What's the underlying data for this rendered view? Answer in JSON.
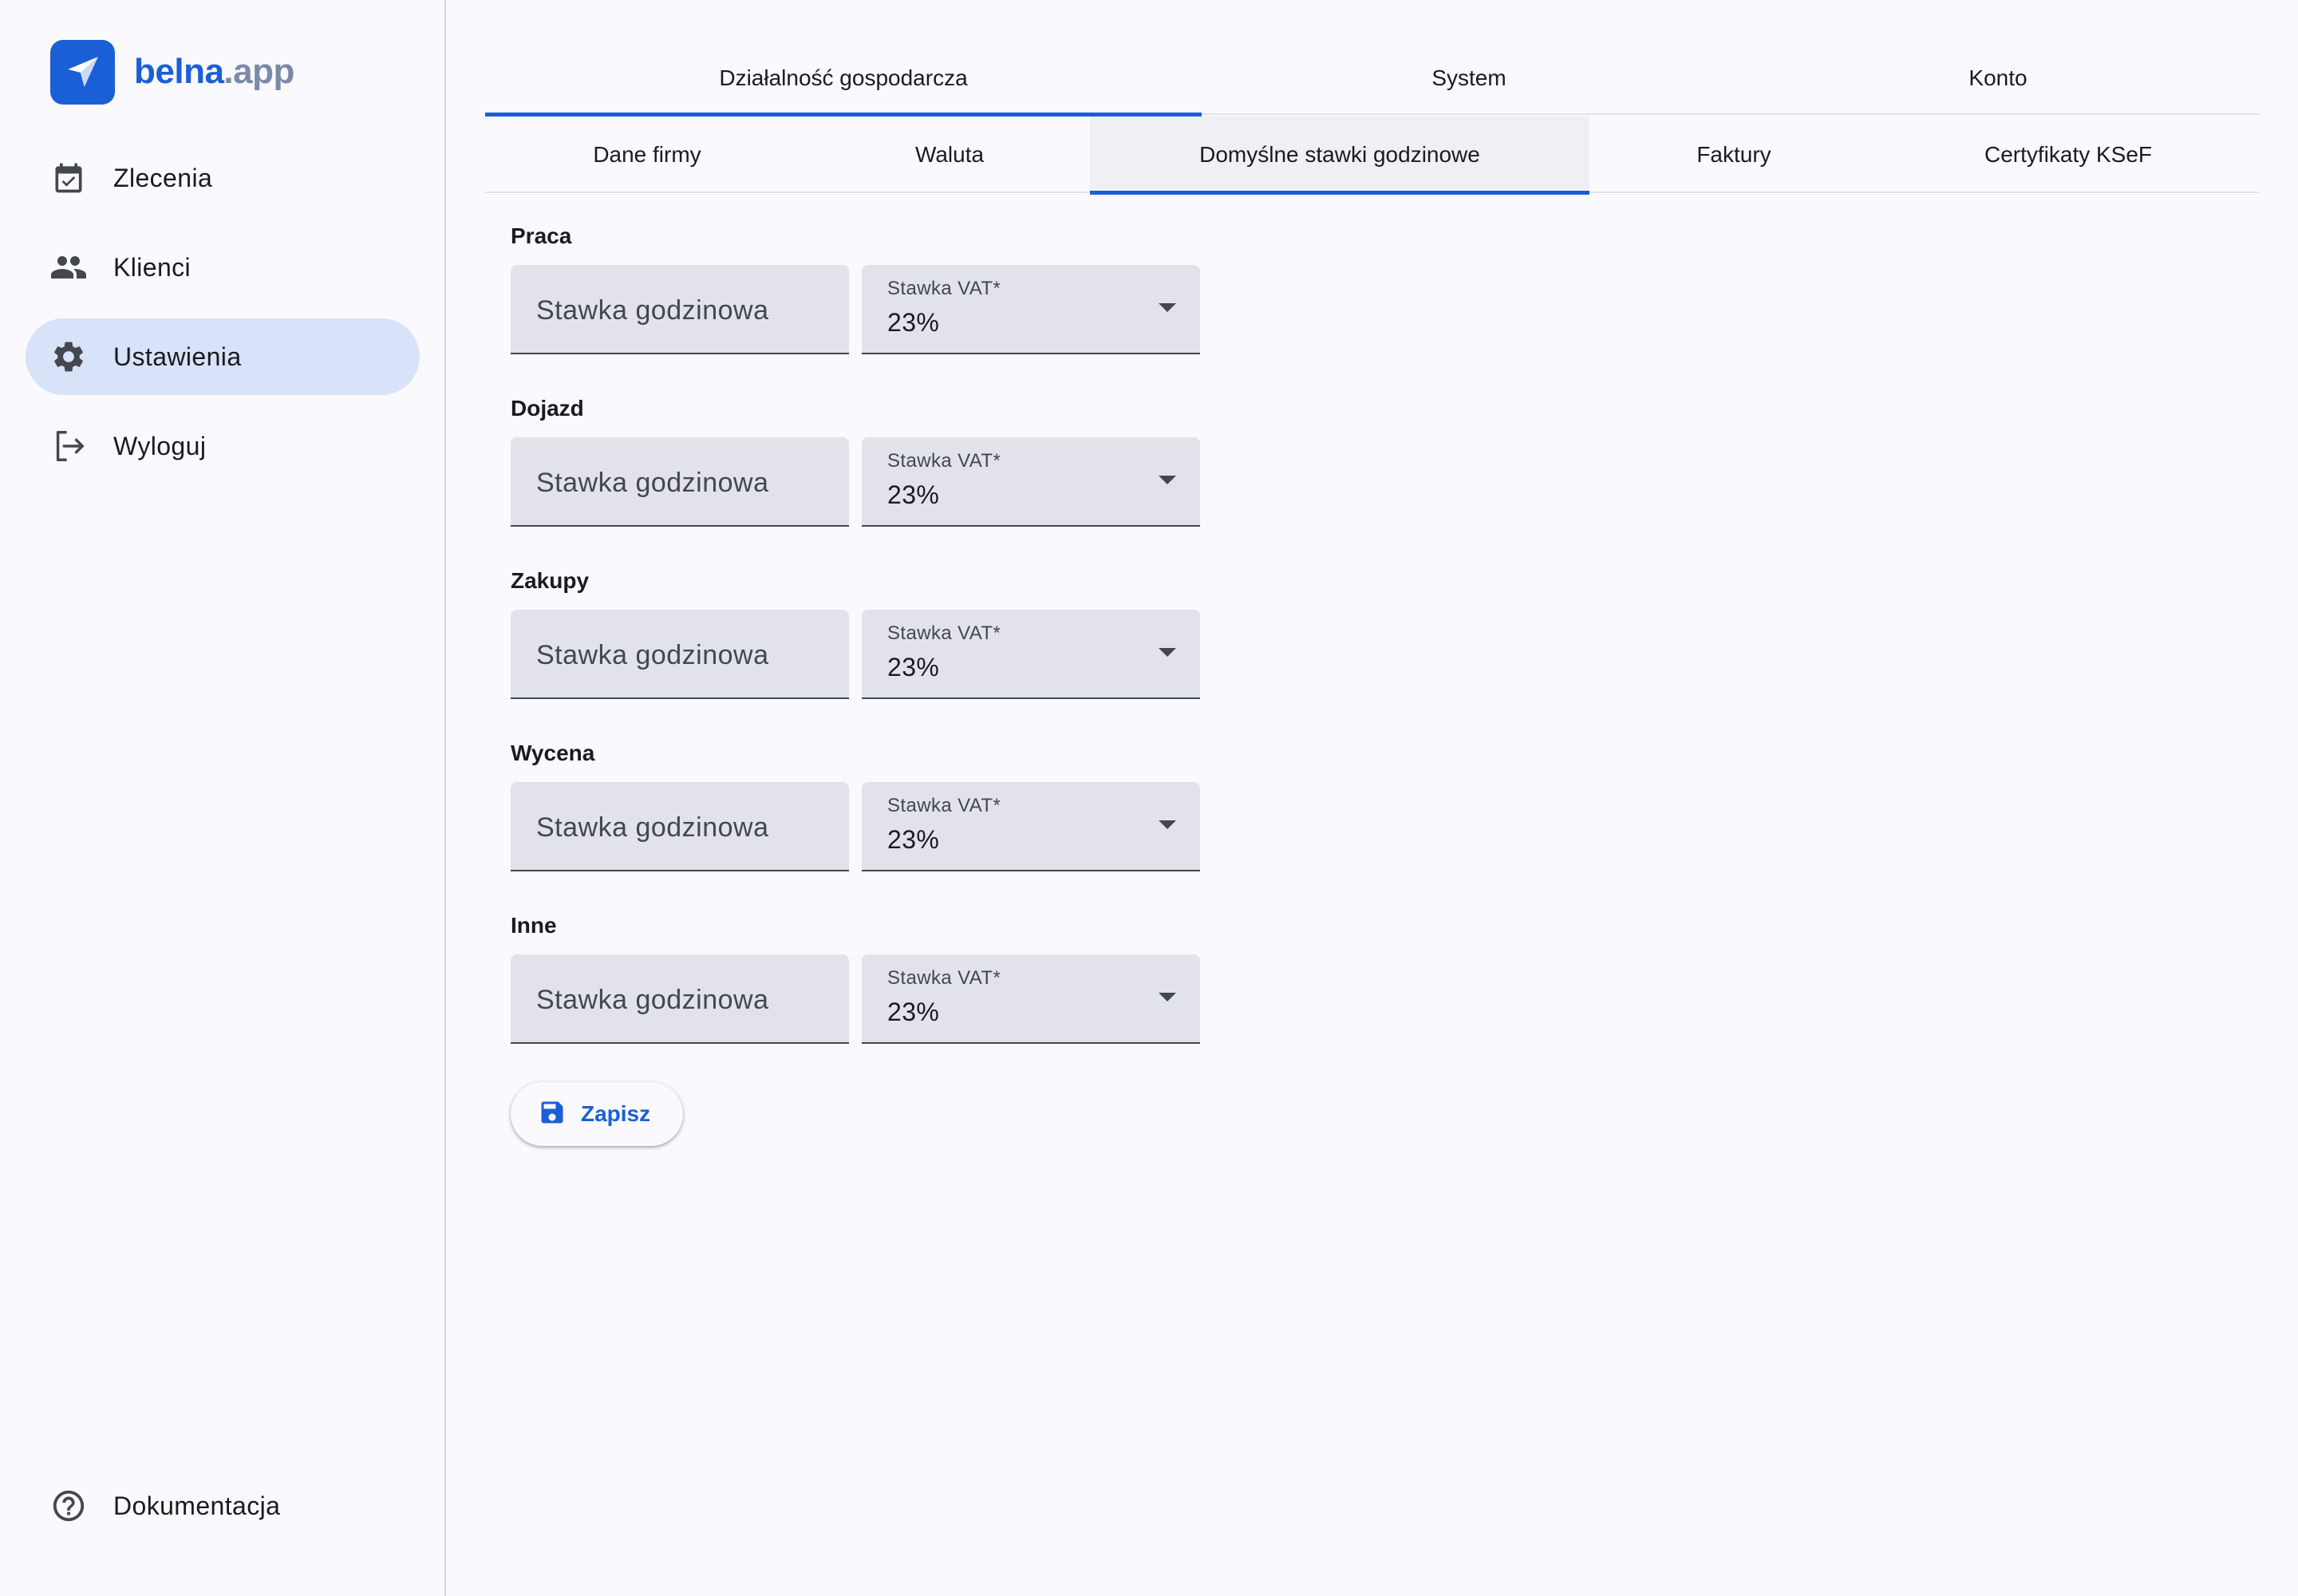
{
  "brand": {
    "name_part1": "belna",
    "name_part2": ".app",
    "accent": "#1a5fd6"
  },
  "sidebar": {
    "items": [
      {
        "label": "Zlecenia",
        "icon": "calendar-check-icon"
      },
      {
        "label": "Klienci",
        "icon": "people-icon"
      },
      {
        "label": "Ustawienia",
        "icon": "gear-icon",
        "active": true
      },
      {
        "label": "Wyloguj",
        "icon": "logout-icon"
      }
    ],
    "footer": {
      "label": "Dokumentacja",
      "icon": "help-circle-icon"
    }
  },
  "tabs_top": [
    {
      "label": "Działalność gospodarcza",
      "active": true
    },
    {
      "label": "System"
    },
    {
      "label": "Konto"
    }
  ],
  "tabs_sub": [
    {
      "label": "Dane firmy"
    },
    {
      "label": "Waluta"
    },
    {
      "label": "Domyślne stawki godzinowe",
      "active": true
    },
    {
      "label": "Faktury"
    },
    {
      "label": "Certyfikaty KSeF"
    }
  ],
  "sections": [
    {
      "label": "Praca",
      "rate_placeholder": "Stawka godzinowa",
      "vat_label": "Stawka VAT*",
      "vat_value": "23%"
    },
    {
      "label": "Dojazd",
      "rate_placeholder": "Stawka godzinowa",
      "vat_label": "Stawka VAT*",
      "vat_value": "23%"
    },
    {
      "label": "Zakupy",
      "rate_placeholder": "Stawka godzinowa",
      "vat_label": "Stawka VAT*",
      "vat_value": "23%"
    },
    {
      "label": "Wycena",
      "rate_placeholder": "Stawka godzinowa",
      "vat_label": "Stawka VAT*",
      "vat_value": "23%"
    },
    {
      "label": "Inne",
      "rate_placeholder": "Stawka godzinowa",
      "vat_label": "Stawka VAT*",
      "vat_value": "23%"
    }
  ],
  "save_button": {
    "label": "Zapisz",
    "icon": "floppy-disk-icon"
  }
}
